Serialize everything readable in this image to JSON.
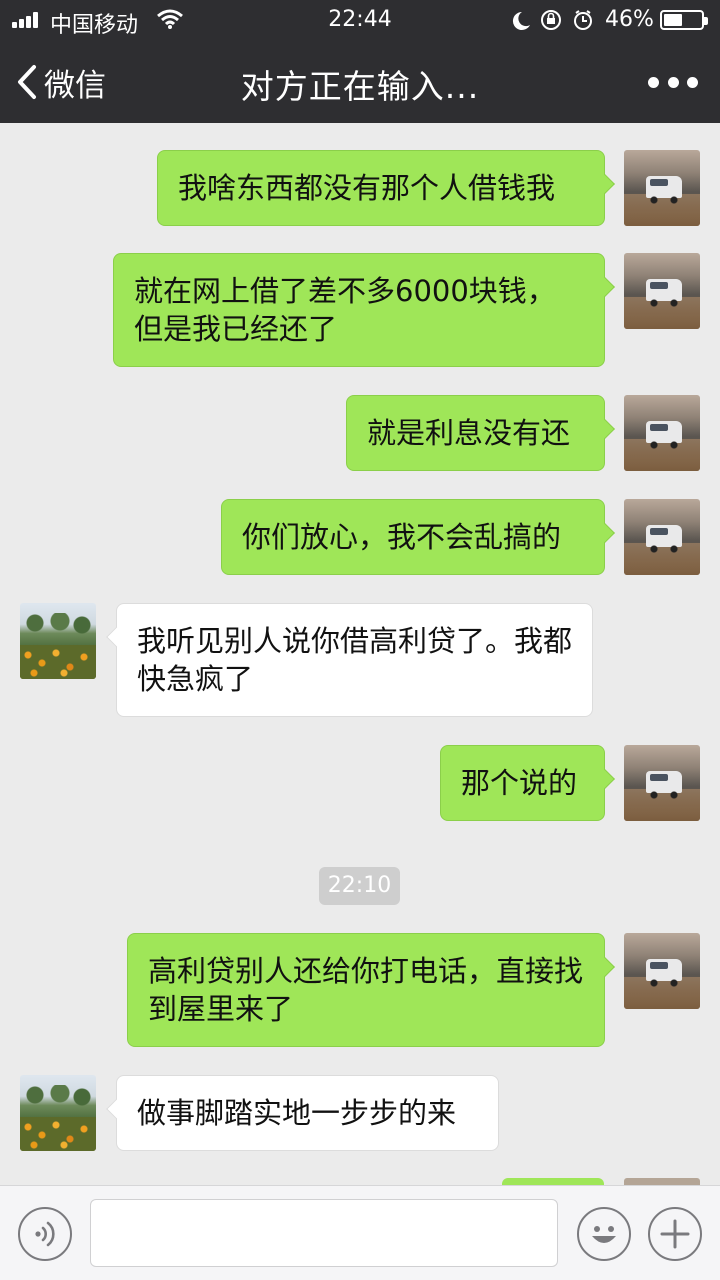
{
  "status_bar": {
    "carrier": "中国移动",
    "time": "22:44",
    "battery_percent": "46%"
  },
  "nav": {
    "back_label": "微信",
    "title": "对方正在输入..."
  },
  "messages": [
    {
      "from": "me",
      "text": "我啥东西都没有那个人借钱我"
    },
    {
      "from": "me",
      "text": "就在网上借了差不多6000块钱，但是我已经还了"
    },
    {
      "from": "me",
      "text": "就是利息没有还"
    },
    {
      "from": "me",
      "text": "你们放心，我不会乱搞的"
    },
    {
      "from": "other",
      "text": "我听见别人说你借高利贷了。我都快急疯了"
    },
    {
      "from": "me",
      "text": "那个说的"
    },
    {
      "from": "me",
      "text": "高利贷别人还给你打电话，直接找到屋里来了"
    },
    {
      "from": "other",
      "text": "做事脚踏实地一步步的来"
    }
  ],
  "timestamp_chip": "22:10",
  "input": {
    "value": "",
    "placeholder": ""
  },
  "icons": {
    "back": "chevron-left-icon",
    "more": "more-dots-icon",
    "voice": "voice-icon",
    "emoji": "emoji-icon",
    "plus": "plus-icon"
  },
  "colors": {
    "header_bg": "#2e2e31",
    "chat_bg": "#ebebeb",
    "my_bubble": "#9fe658",
    "other_bubble": "#ffffff"
  }
}
